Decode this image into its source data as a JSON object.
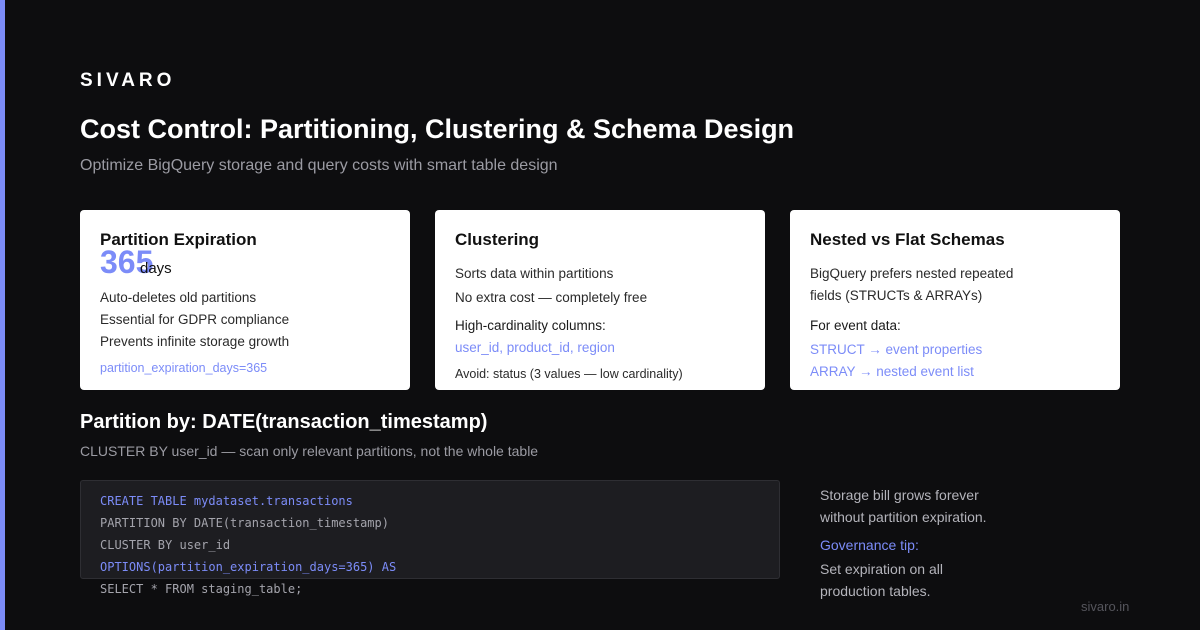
{
  "brand": "SIVARO",
  "title": "Cost Control: Partitioning, Clustering & Schema Design",
  "subtitle": "Optimize BigQuery storage and query costs with smart table design",
  "colors": {
    "background": "#0d0d0f",
    "accent": "#7c8cf8",
    "card_bg": "#ffffff",
    "code_bg": "#1d1d21"
  },
  "cards": [
    {
      "title": "Partition Expiration",
      "big_number": "365",
      "big_unit": "days",
      "lines": [
        "Auto-deletes old partitions",
        "Essential for GDPR compliance",
        "Prevents infinite storage growth"
      ],
      "footer": "partition_expiration_days=365"
    },
    {
      "title": "Clustering",
      "lines": [
        "Sorts data within partitions",
        "No extra cost — completely free"
      ],
      "label": "High-cardinality columns:",
      "columns": "user_id, product_id, region",
      "avoid": "Avoid: status (3 values — low cardinality)"
    },
    {
      "title": "Nested vs Flat Schemas",
      "lines": [
        "BigQuery prefers nested repeated",
        "fields (STRUCTs & ARRAYs)"
      ],
      "label": "For event data:",
      "items": [
        "STRUCT → event properties",
        "ARRAY → nested event list"
      ]
    }
  ],
  "section": {
    "title": "Partition by: DATE(transaction_timestamp)",
    "subtitle": "CLUSTER BY user_id — scan only relevant partitions, not the whole table"
  },
  "code": [
    "CREATE TABLE mydataset.transactions",
    "PARTITION BY DATE(transaction_timestamp)",
    "CLUSTER BY user_id",
    "OPTIONS(partition_expiration_days=365) AS",
    "SELECT * FROM staging_table;"
  ],
  "side_note": {
    "lines": [
      "Storage bill grows forever",
      "without partition expiration."
    ],
    "tip_label": "Governance tip:",
    "tip_lines": [
      "Set expiration on all",
      "production tables."
    ]
  },
  "footer_url": "sivaro.in"
}
